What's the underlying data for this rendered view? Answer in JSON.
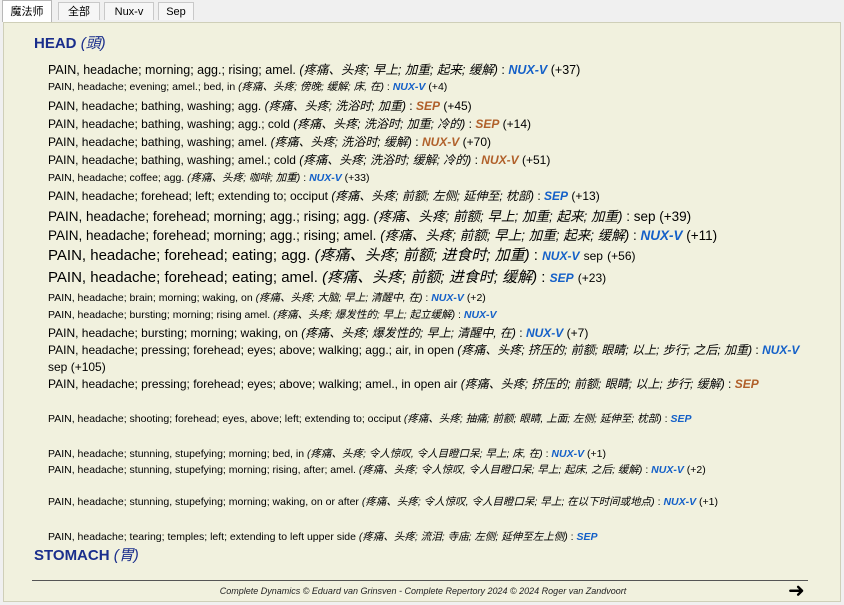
{
  "tabs": [
    {
      "label": "魔法师",
      "active": true
    },
    {
      "label": "全部",
      "active": false
    },
    {
      "label": "Nux-v",
      "active": false
    },
    {
      "label": "Sep",
      "active": false
    }
  ],
  "chapters": {
    "head": {
      "name": "HEAD",
      "tr": "(頭)"
    },
    "stomach": {
      "name": "STOMACH",
      "tr": "(胃)"
    }
  },
  "rubrics": [
    {
      "text": "PAIN, headache; morning; agg.; rising; amel.",
      "tr": "(疼痛、头疼; 早上; 加重; 起来; 缓解)",
      "rem": "NUX-V",
      "count": "(+37)"
    },
    {
      "text": "PAIN, headache; evening; amel.; bed, in",
      "tr": "(疼痛、头疼; 傍晚; 缓解; 床, 在)",
      "rem": "NUX-V",
      "count": "(+4)"
    },
    {
      "text": "PAIN, headache; bathing, washing; agg.",
      "tr": "(疼痛、头疼; 洗浴时; 加重)",
      "rem": "SEP",
      "count": "(+45)"
    },
    {
      "text": "PAIN, headache; bathing, washing; agg.; cold",
      "tr": "(疼痛、头疼; 洗浴时; 加重; 冷的)",
      "rem": "SEP",
      "count": "(+14)"
    },
    {
      "text": "PAIN, headache; bathing, washing; amel.",
      "tr": "(疼痛、头疼; 洗浴时; 缓解)",
      "rem": "NUX-V",
      "count": "(+70)"
    },
    {
      "text": "PAIN, headache; bathing, washing; amel.; cold",
      "tr": "(疼痛、头疼; 洗浴时; 缓解; 冷的)",
      "rem": "NUX-V",
      "count": "(+51)"
    },
    {
      "text": "PAIN, headache; coffee; agg.",
      "tr": "(疼痛、头疼; 咖啡; 加重)",
      "rem": "NUX-V",
      "count": "(+33)"
    },
    {
      "text": "PAIN, headache; forehead; left; extending to; occiput",
      "tr": "(疼痛、头疼; 前额; 左侧; 延伸至; 枕部)",
      "rem": "SEP",
      "count": "(+13)"
    },
    {
      "text": "PAIN, headache; forehead; morning; agg.; rising; agg.",
      "tr": "(疼痛、头疼; 前额; 早上; 加重; 起来; 加重)",
      "rem": "sep",
      "count": "(+39)"
    },
    {
      "text": "PAIN, headache; forehead; morning; agg.; rising; amel.",
      "tr": "(疼痛、头疼; 前额; 早上; 加重; 起来; 缓解)",
      "rem": "NUX-V",
      "count": "(+11)"
    },
    {
      "text": "PAIN, headache; forehead; eating; agg.",
      "tr": "(疼痛、头疼; 前额; 进食时; 加重)",
      "rem": "NUX-V",
      "rem2": "sep",
      "count": "(+56)"
    },
    {
      "text": "PAIN, headache; forehead; eating; amel.",
      "tr": "(疼痛、头疼; 前额; 进食时; 缓解)",
      "rem": "SEP",
      "count": "(+23)"
    },
    {
      "text": "PAIN, headache; brain; morning; waking, on",
      "tr": "(疼痛、头疼; 大脑; 早上; 清醒中, 在)",
      "rem": "NUX-V",
      "count": "(+2)"
    },
    {
      "text": "PAIN, headache; bursting; morning; rising amel.",
      "tr": "(疼痛、头疼; 爆发性的; 早上; 起立缓解)",
      "rem": "NUX-V",
      "count": ""
    },
    {
      "text": "PAIN, headache; bursting; morning; waking, on",
      "tr": "(疼痛、头疼; 爆发性的; 早上; 清醒中, 在)",
      "rem": "NUX-V",
      "count": "(+7)"
    },
    {
      "text": "PAIN, headache; pressing; forehead; eyes; above; walking; agg.; air, in open",
      "tr": "(疼痛、头疼; 挤压的; 前额; 眼睛; 以上; 步行; 之后; 加重)",
      "rem": "NUX-V",
      "rem2": "sep",
      "count": "(+105)"
    },
    {
      "text": "PAIN, headache; pressing; forehead; eyes; above; walking; amel., in open air",
      "tr": "(疼痛、头疼; 挤压的; 前额; 眼睛; 以上; 步行; 缓解)",
      "rem": "SEP",
      "count": ""
    },
    {
      "text": "PAIN, headache; shooting; forehead; eyes, above; left; extending to; occiput",
      "tr": "(疼痛、头疼; 抽痛; 前额; 眼睛, 上面; 左侧; 延伸至; 枕部)",
      "rem": "SEP",
      "count": ""
    },
    {
      "text": "PAIN, headache; stunning, stupefying; morning; bed, in",
      "tr": "(疼痛、头疼; 令人惊叹, 令人目瞪口呆; 早上; 床, 在)",
      "rem": "NUX-V",
      "count": "(+1)"
    },
    {
      "text": "PAIN, headache; stunning, stupefying; morning; rising, after; amel.",
      "tr": "(疼痛、头疼; 令人惊叹, 令人目瞪口呆; 早上; 起床, 之后; 缓解)",
      "rem": "NUX-V",
      "count": "(+2)"
    },
    {
      "text": "PAIN, headache; stunning, stupefying; morning; waking, on or after",
      "tr": "(疼痛、头疼; 令人惊叹, 令人目瞪口呆; 早上; 在以下时间或地点)",
      "rem": "NUX-V",
      "count": "(+1)"
    },
    {
      "text": "PAIN, headache; tearing; temples; left; extending to left upper side",
      "tr": "(疼痛、头疼; 流泪; 寺庙; 左侧; 延伸至左上侧)",
      "rem": "SEP",
      "count": ""
    }
  ],
  "footer": "Complete Dynamics © Eduard van Grinsven  -  Complete Repertory 2024 © 2024 Roger van Zandvoort",
  "next_icon": "arrow-right-icon"
}
